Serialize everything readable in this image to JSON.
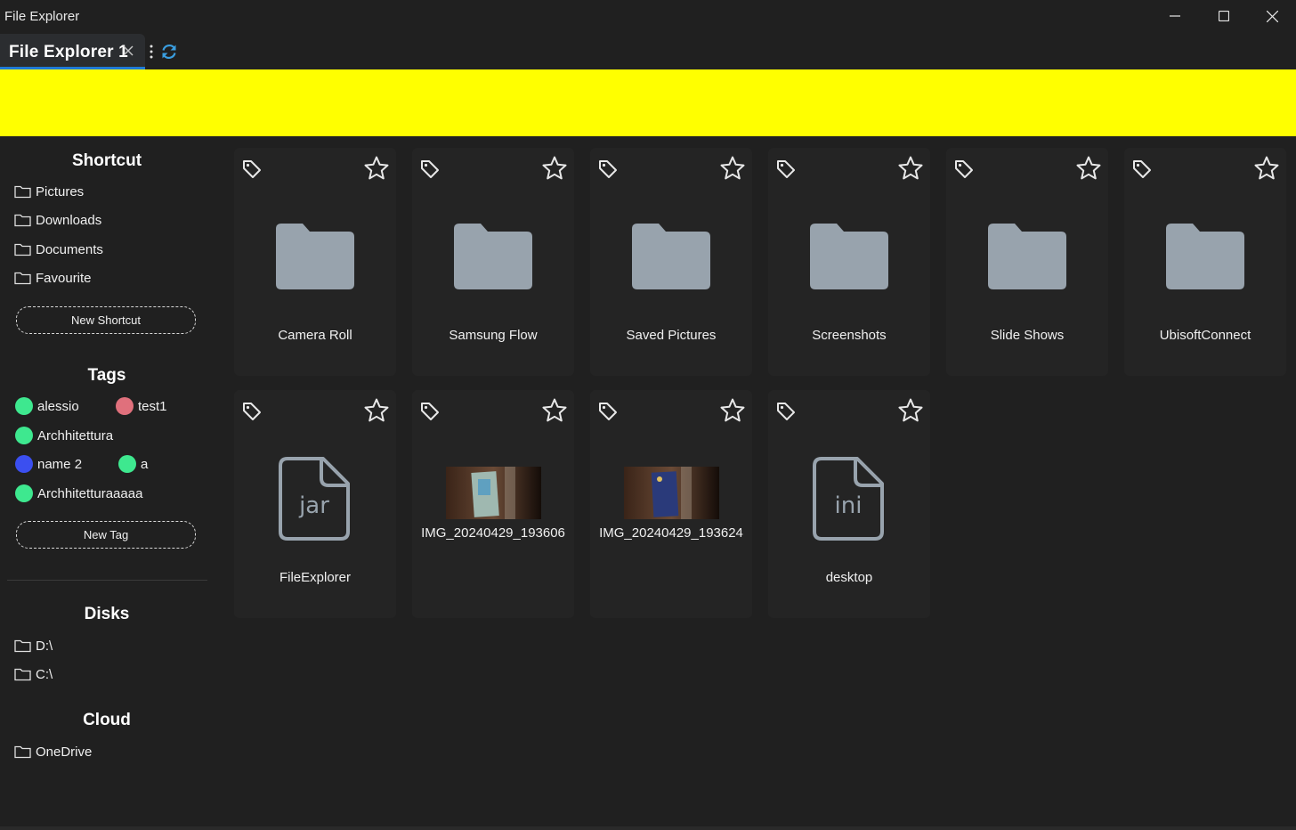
{
  "window": {
    "title": "File Explorer",
    "controls": [
      "minimize-icon",
      "maximize-icon",
      "close-icon"
    ]
  },
  "tabs": [
    {
      "label": "File Explorer 1",
      "active": true
    }
  ],
  "toolbar": {
    "menu_icon": "kebab-icon",
    "refresh_icon": "refresh-icon"
  },
  "banner": {
    "color": "#ffff00"
  },
  "sidebar": {
    "shortcut_title": "Shortcut",
    "shortcuts": [
      {
        "label": "Pictures"
      },
      {
        "label": "Downloads"
      },
      {
        "label": "Documents"
      },
      {
        "label": "Favourite"
      }
    ],
    "new_shortcut_label": "New Shortcut",
    "tags_title": "Tags",
    "tags": [
      {
        "label": "alessio",
        "color": "#3ee88f"
      },
      {
        "label": "test1",
        "color": "#e0707c"
      },
      {
        "label": "Archhitettura",
        "color": "#3ee88f"
      },
      {
        "label": "name 2",
        "color": "#3b4ff0"
      },
      {
        "label": "a",
        "color": "#3ee88f"
      },
      {
        "label": "Archhitetturaaaaa",
        "color": "#3ee88f"
      }
    ],
    "new_tag_label": "New Tag",
    "disks_title": "Disks",
    "disks": [
      {
        "label": "D:\\"
      },
      {
        "label": "C:\\"
      }
    ],
    "cloud_title": "Cloud",
    "cloud": [
      {
        "label": "OneDrive"
      }
    ]
  },
  "items": [
    {
      "name": "Camera Roll",
      "kind": "folder"
    },
    {
      "name": "Samsung Flow",
      "kind": "folder"
    },
    {
      "name": "Saved Pictures",
      "kind": "folder"
    },
    {
      "name": "Screenshots",
      "kind": "folder"
    },
    {
      "name": "Slide Shows",
      "kind": "folder"
    },
    {
      "name": "UbisoftConnect",
      "kind": "folder"
    },
    {
      "name": "FileExplorer",
      "kind": "file",
      "ext": "jar"
    },
    {
      "name": "IMG_20240429_193606",
      "kind": "image"
    },
    {
      "name": "IMG_20240429_193624",
      "kind": "image"
    },
    {
      "name": "desktop",
      "kind": "file",
      "ext": "ini"
    }
  ]
}
